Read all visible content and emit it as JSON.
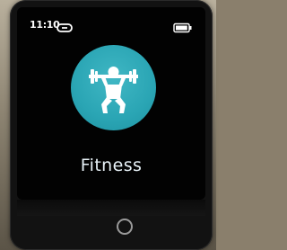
{
  "status_bar": {
    "time": "11:10",
    "link_icon": "link-icon",
    "battery_icon": "battery-icon",
    "battery_level": 0.85
  },
  "app": {
    "icon": "weightlifting-icon",
    "icon_color": "#2aa5b4",
    "label": "Fitness"
  },
  "hardware": {
    "home_button_icon": "home-button"
  }
}
